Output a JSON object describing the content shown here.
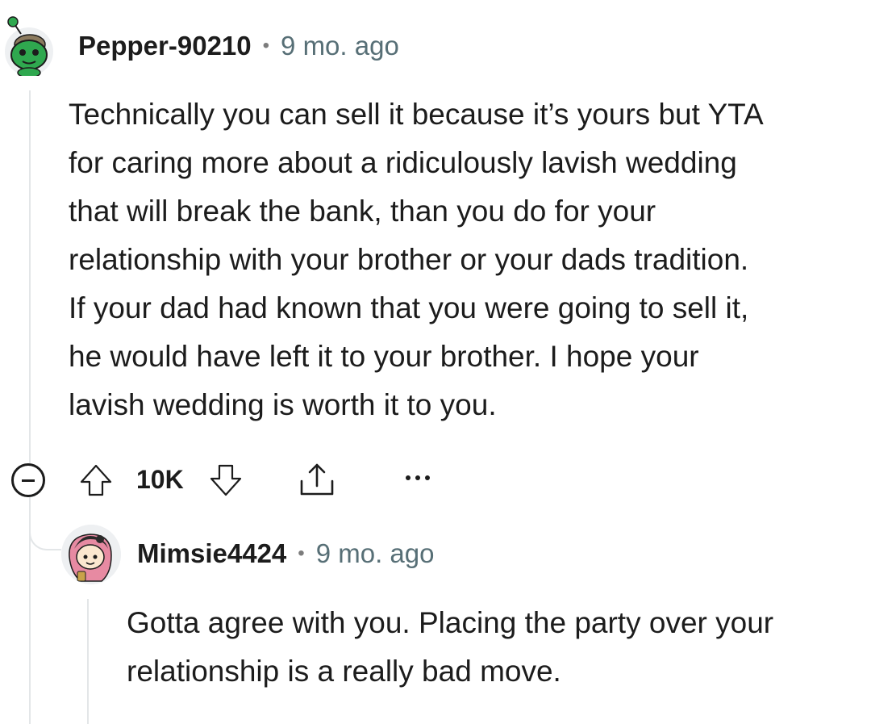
{
  "comment": {
    "author": "Pepper-90210",
    "separator": "•",
    "time": "9 mo. ago",
    "avatar_icon": "snoo-avatar-icon",
    "body_lines": [
      "Technically you can sell it because it’s yours but YTA",
      "for caring more about a ridiculously lavish wedding",
      "that will break the bank, than you do for your",
      "relationship with your brother or your dads tradition.",
      "If your dad had known that you were going to sell it,",
      "he would have left it to your brother. I hope your",
      "lavish wedding is worth it to you."
    ],
    "actions": {
      "collapse_icon": "collapse-minus-icon",
      "upvote_icon": "upvote-arrow-icon",
      "score": "10K",
      "downvote_icon": "downvote-arrow-icon",
      "share_icon": "share-icon",
      "more_icon": "more-options-icon",
      "more_label": "•••"
    }
  },
  "reply": {
    "author": "Mimsie4424",
    "separator": "•",
    "time": "9 mo. ago",
    "avatar_icon": "snoo-avatar-icon",
    "body_lines": [
      "Gotta agree with you. Placing the party over your",
      "relationship is a really bad move."
    ]
  },
  "colors": {
    "thread_line": "#e3e6e8",
    "time_text": "#576f76",
    "text": "#1c1c1c",
    "avatar_green": "#2fa84f"
  }
}
